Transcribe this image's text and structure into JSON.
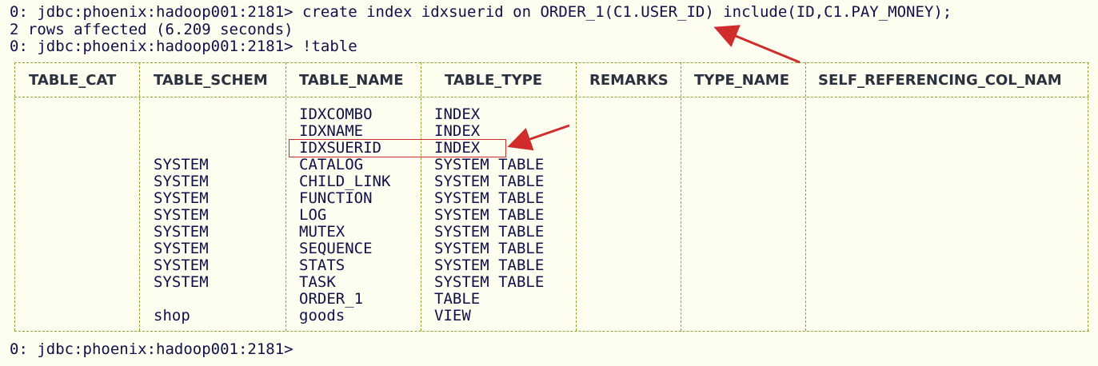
{
  "terminal": {
    "lines": {
      "cmd1": "0: jdbc:phoenix:hadoop001:2181> create index idxsuerid on ORDER_1(C1.USER_ID) include(ID,C1.PAY_MONEY);",
      "result": "2 rows affected (6.209 seconds)",
      "cmd2": "0: jdbc:phoenix:hadoop001:2181> !table",
      "prompt": "0: jdbc:phoenix:hadoop001:2181>"
    }
  },
  "table": {
    "columns": [
      "TABLE_CAT",
      "TABLE_SCHEM",
      "TABLE_NAME",
      "TABLE_TYPE",
      "REMARKS",
      "TYPE_NAME",
      "SELF_REFERENCING_COL_NAM"
    ],
    "rows": [
      {
        "schem": "",
        "name": "IDXCOMBO",
        "type": "INDEX"
      },
      {
        "schem": "",
        "name": "IDXNAME",
        "type": "INDEX"
      },
      {
        "schem": "",
        "name": "IDXSUERID",
        "type": "INDEX"
      },
      {
        "schem": "SYSTEM",
        "name": "CATALOG",
        "type": "SYSTEM TABLE"
      },
      {
        "schem": "SYSTEM",
        "name": "CHILD_LINK",
        "type": "SYSTEM TABLE"
      },
      {
        "schem": "SYSTEM",
        "name": "FUNCTION",
        "type": "SYSTEM TABLE"
      },
      {
        "schem": "SYSTEM",
        "name": "LOG",
        "type": "SYSTEM TABLE"
      },
      {
        "schem": "SYSTEM",
        "name": "MUTEX",
        "type": "SYSTEM TABLE"
      },
      {
        "schem": "SYSTEM",
        "name": "SEQUENCE",
        "type": "SYSTEM TABLE"
      },
      {
        "schem": "SYSTEM",
        "name": "STATS",
        "type": "SYSTEM TABLE"
      },
      {
        "schem": "SYSTEM",
        "name": "TASK",
        "type": "SYSTEM TABLE"
      },
      {
        "schem": "",
        "name": "ORDER_1",
        "type": "TABLE"
      },
      {
        "schem": "shop",
        "name": "goods",
        "type": "VIEW"
      }
    ]
  },
  "colors": {
    "background": "#fdfdf0",
    "text": "#10104a",
    "border": "#8aa62a",
    "annotation": "#d12c2c"
  }
}
